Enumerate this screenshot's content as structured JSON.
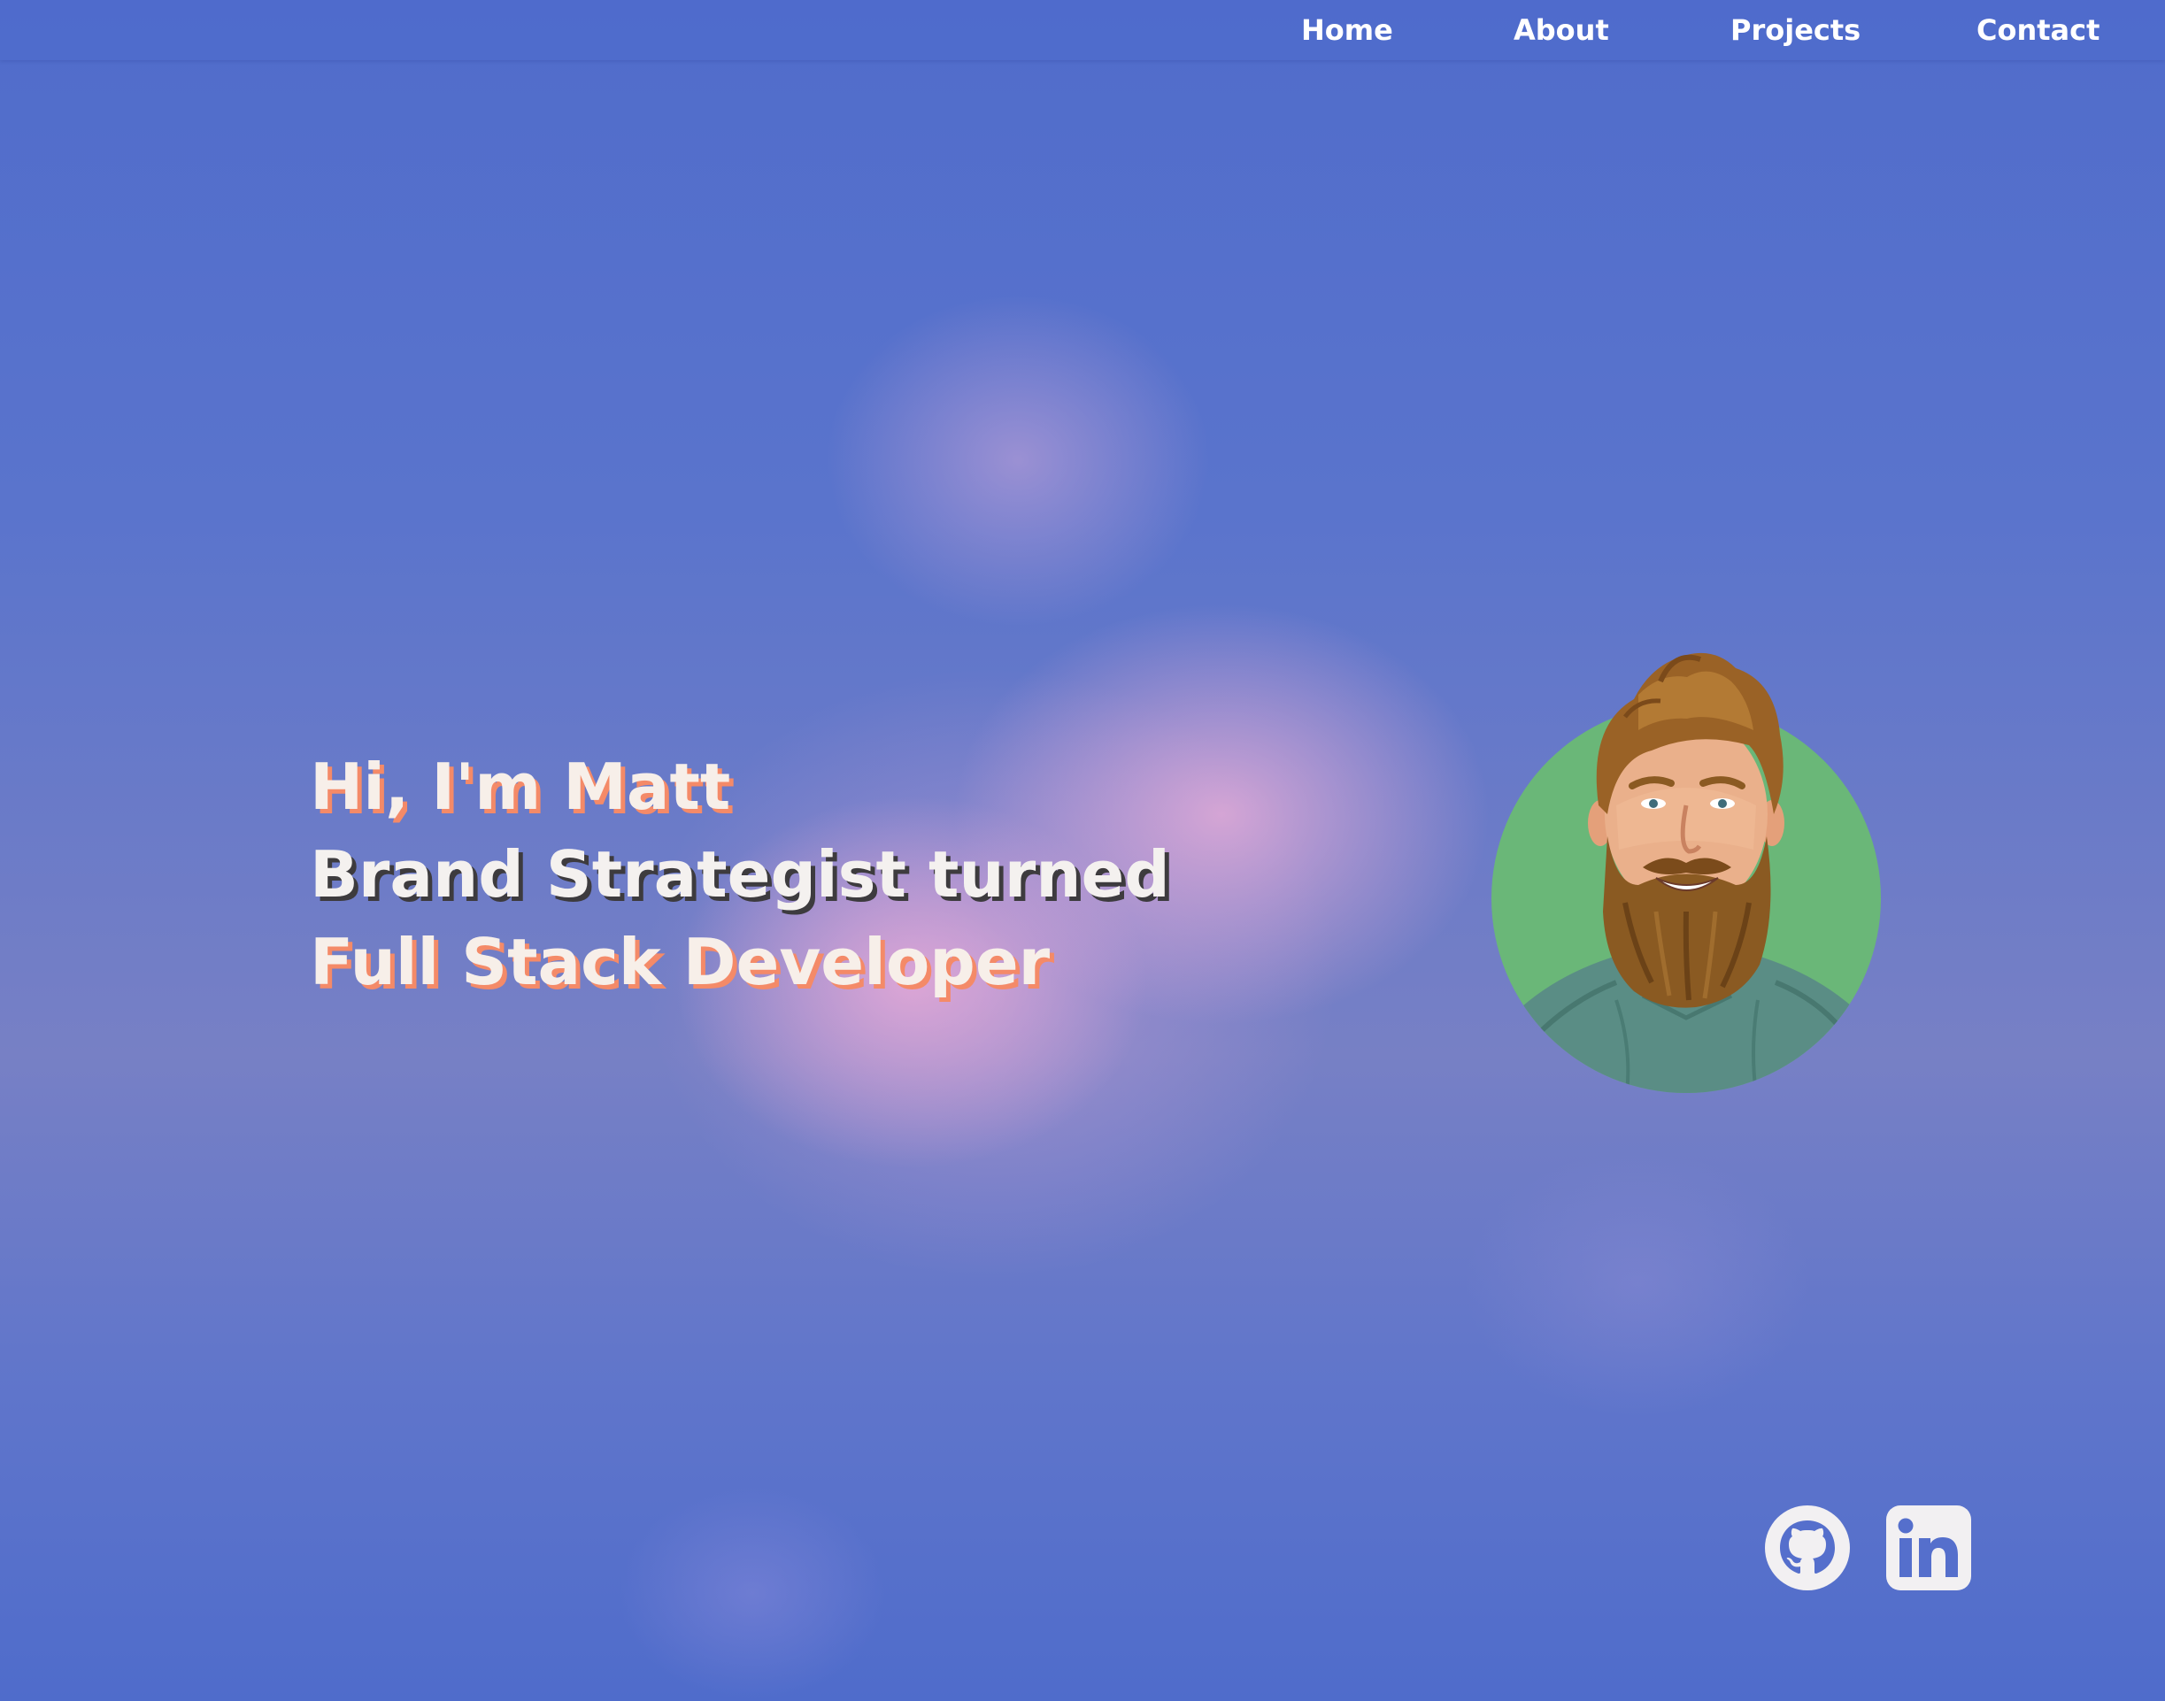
{
  "nav": {
    "items": [
      {
        "label": "Home"
      },
      {
        "label": "About"
      },
      {
        "label": "Projects"
      },
      {
        "label": "Contact"
      }
    ]
  },
  "hero": {
    "line1": "Hi, I'm Matt",
    "line2": "Brand Strategist turned",
    "line3": "Full Stack Developer"
  },
  "social": {
    "github_icon": "github-icon",
    "linkedin_icon": "linkedin-icon"
  },
  "colors": {
    "background": "#556fcc",
    "accent_shadow": "#f48a68",
    "dark_shadow": "#3d3b3e",
    "avatar_bg": "#6ab778",
    "icon": "#f2f0f2"
  }
}
